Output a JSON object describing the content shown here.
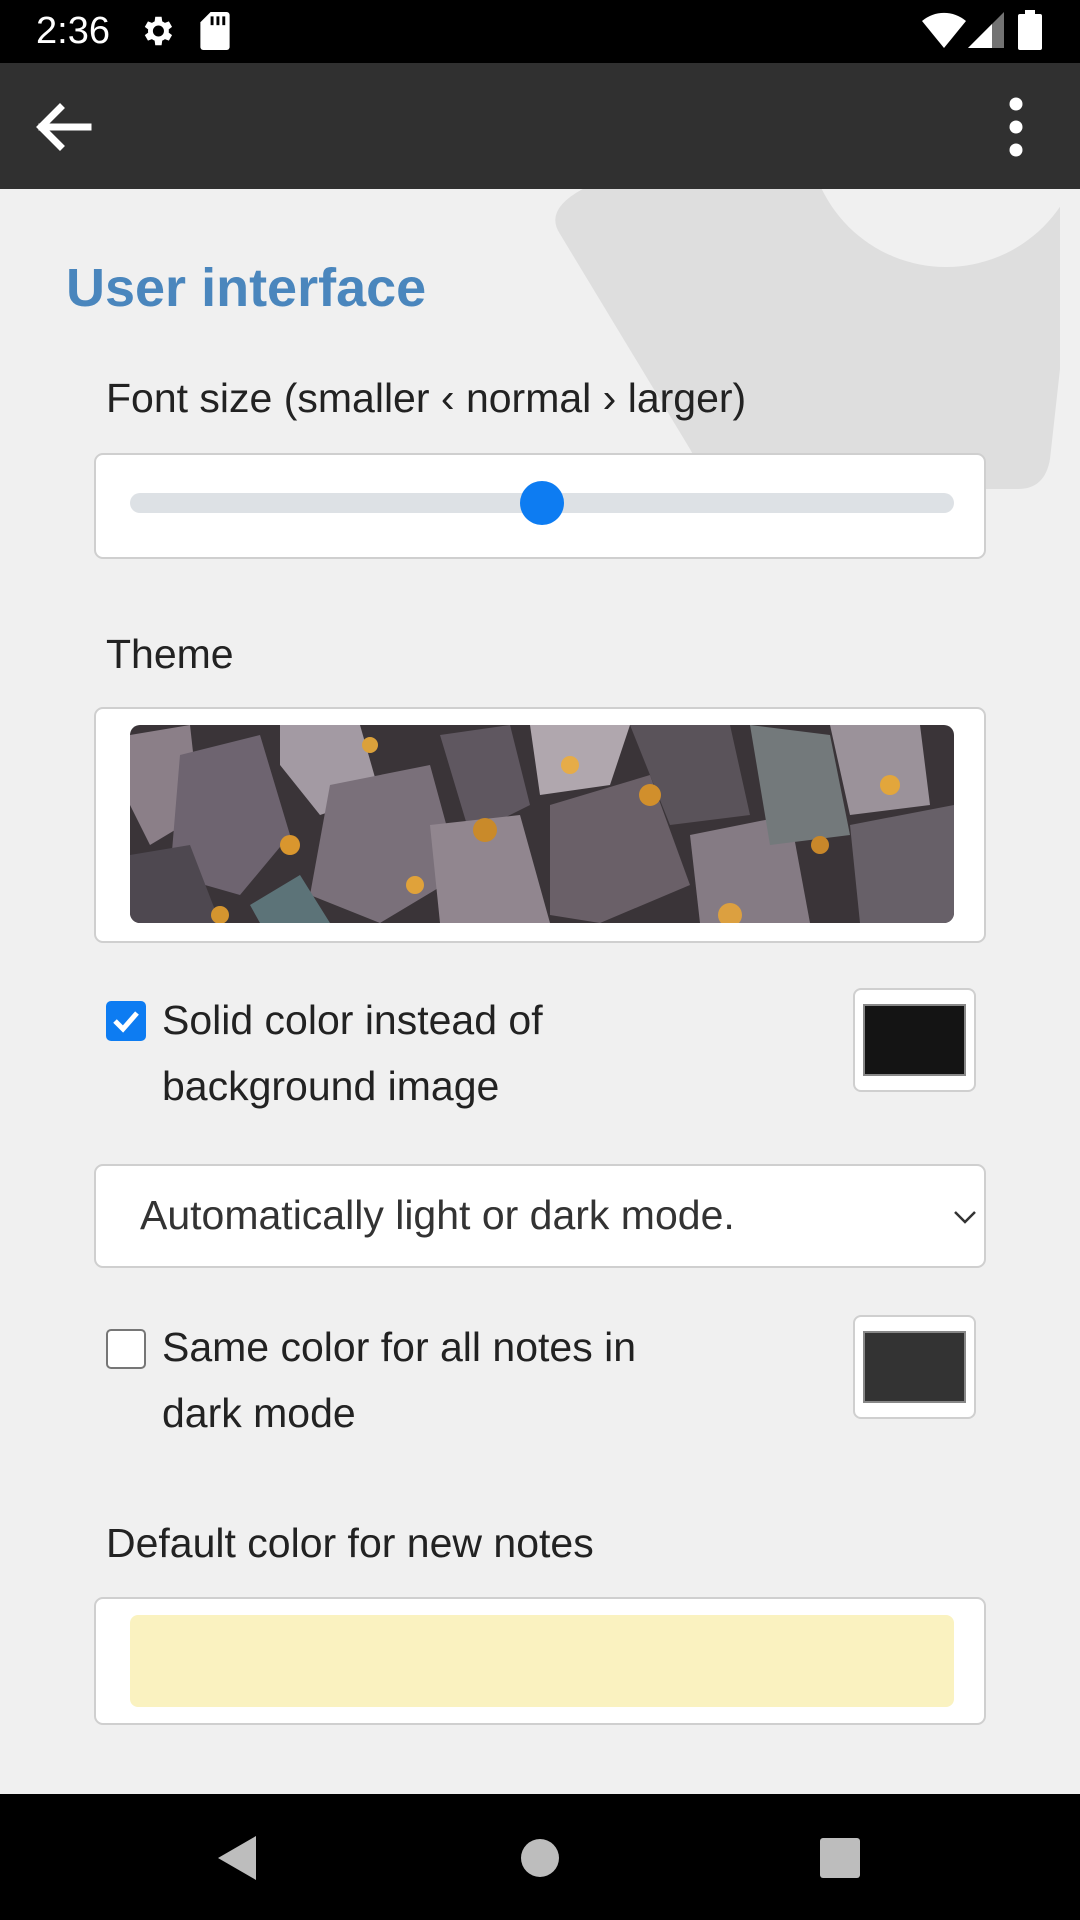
{
  "status_bar": {
    "time": "2:36",
    "icons": [
      "gear-icon",
      "sd-card-icon",
      "wifi-icon",
      "signal-icon",
      "battery-icon"
    ]
  },
  "app_bar": {
    "back_icon": "arrow-left-icon",
    "menu_icon": "more-vert-icon"
  },
  "settings": {
    "section_title": "User interface",
    "font_size": {
      "label": "Font size (smaller ‹ normal › larger)",
      "value_fraction": 0.5
    },
    "theme": {
      "label": "Theme",
      "image": "rock-texture-image"
    },
    "solid_color": {
      "label": "Solid color instead of background image",
      "checked": true,
      "color": "#141414"
    },
    "mode_select": {
      "value": "Automatically light or dark mode."
    },
    "same_color_dark": {
      "label": "Same color for all notes in dark mode",
      "checked": false,
      "color": "#333333"
    },
    "default_color": {
      "label": "Default color for new notes",
      "color": "#faf2c0"
    }
  },
  "colors": {
    "accent": "#4a86bd",
    "slider_thumb": "#0d7cf2",
    "app_bar": "#303030"
  },
  "nav_bar": {
    "icons": [
      "nav-back-icon",
      "nav-home-icon",
      "nav-recents-icon"
    ]
  }
}
